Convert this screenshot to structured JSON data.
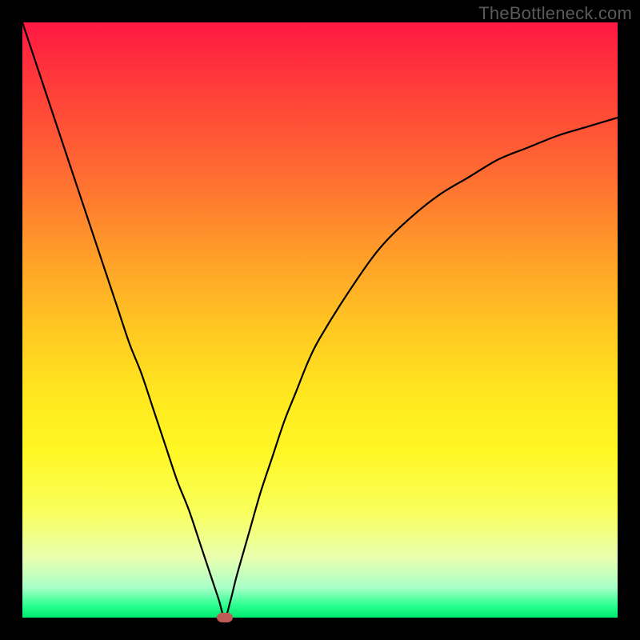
{
  "attribution": "TheBottleneck.com",
  "chart_data": {
    "type": "line",
    "title": "",
    "xlabel": "",
    "ylabel": "",
    "xlim": [
      0,
      100
    ],
    "ylim": [
      0,
      100
    ],
    "grid": false,
    "legend": false,
    "background": "gradient_red_to_green",
    "marker": {
      "x": 34,
      "y": 0,
      "color": "#c05a55"
    },
    "series": [
      {
        "name": "curve",
        "color": "#000000",
        "x": [
          0,
          2,
          4,
          6,
          8,
          10,
          12,
          14,
          16,
          18,
          20,
          22,
          24,
          26,
          28,
          30,
          32,
          33,
          34,
          35,
          36,
          38,
          40,
          42,
          44,
          46,
          48,
          50,
          55,
          60,
          65,
          70,
          75,
          80,
          85,
          90,
          95,
          100
        ],
        "y": [
          100,
          94,
          88,
          82,
          76,
          70,
          64,
          58,
          52,
          46,
          41,
          35,
          29,
          23,
          18,
          12,
          6,
          3,
          0,
          3,
          7,
          14,
          21,
          27,
          33,
          38,
          43,
          47,
          55,
          62,
          67,
          71,
          74,
          77,
          79,
          81,
          82.5,
          84
        ]
      }
    ]
  }
}
